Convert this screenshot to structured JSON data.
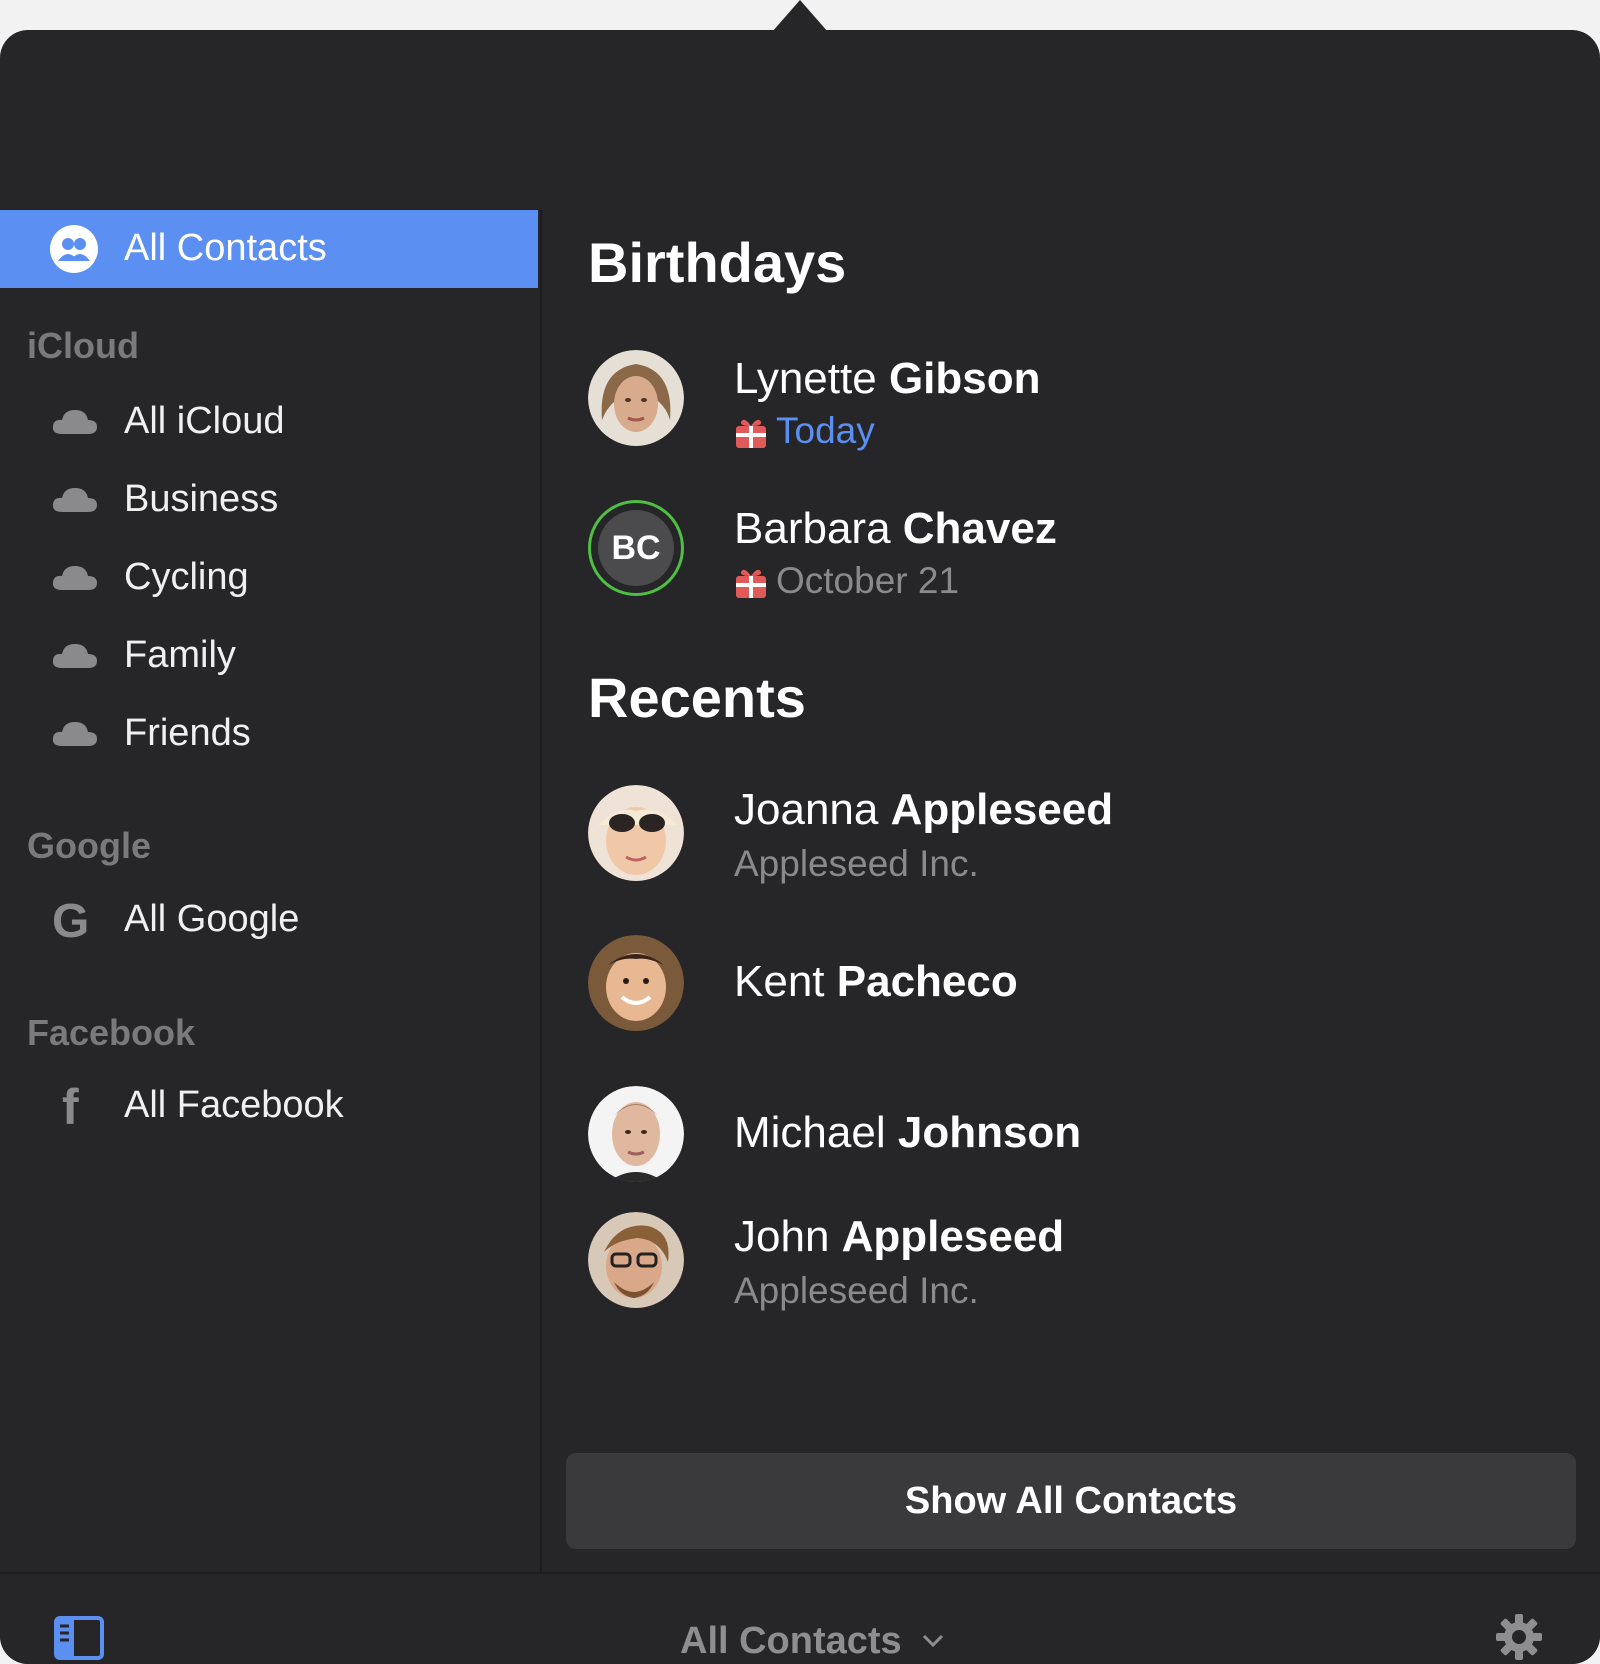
{
  "sidebar": {
    "selected": {
      "label": "All Contacts",
      "icon": "contacts-group-icon"
    },
    "sections": [
      {
        "title": "iCloud",
        "items": [
          {
            "label": "All iCloud",
            "icon": "cloud-icon"
          },
          {
            "label": "Business",
            "icon": "cloud-icon"
          },
          {
            "label": "Cycling",
            "icon": "cloud-icon"
          },
          {
            "label": "Family",
            "icon": "cloud-icon"
          },
          {
            "label": "Friends",
            "icon": "cloud-icon"
          }
        ]
      },
      {
        "title": "Google",
        "items": [
          {
            "label": "All Google",
            "icon": "google-icon",
            "glyph": "G"
          }
        ]
      },
      {
        "title": "Facebook",
        "items": [
          {
            "label": "All Facebook",
            "icon": "facebook-icon",
            "glyph": "f"
          }
        ]
      }
    ]
  },
  "birthdays": {
    "title": "Birthdays",
    "items": [
      {
        "first": "Lynette",
        "last": "Gibson",
        "date": "Today"
      },
      {
        "first": "Barbara",
        "last": "Chavez",
        "date": "October 21",
        "initials": "BC"
      }
    ]
  },
  "recents": {
    "title": "Recents",
    "items": [
      {
        "first": "Joanna",
        "last": "Appleseed",
        "company": "Appleseed Inc."
      },
      {
        "first": "Kent",
        "last": "Pacheco"
      },
      {
        "first": "Michael",
        "last": "Johnson"
      },
      {
        "first": "John",
        "last": "Appleseed",
        "company": "Appleseed Inc."
      }
    ]
  },
  "show_all_label": "Show All Contacts",
  "bottom_bar": {
    "title": "All Contacts"
  },
  "colors": {
    "accent": "#5b8ff2",
    "background": "#262628",
    "ring": "#4fbf43"
  }
}
